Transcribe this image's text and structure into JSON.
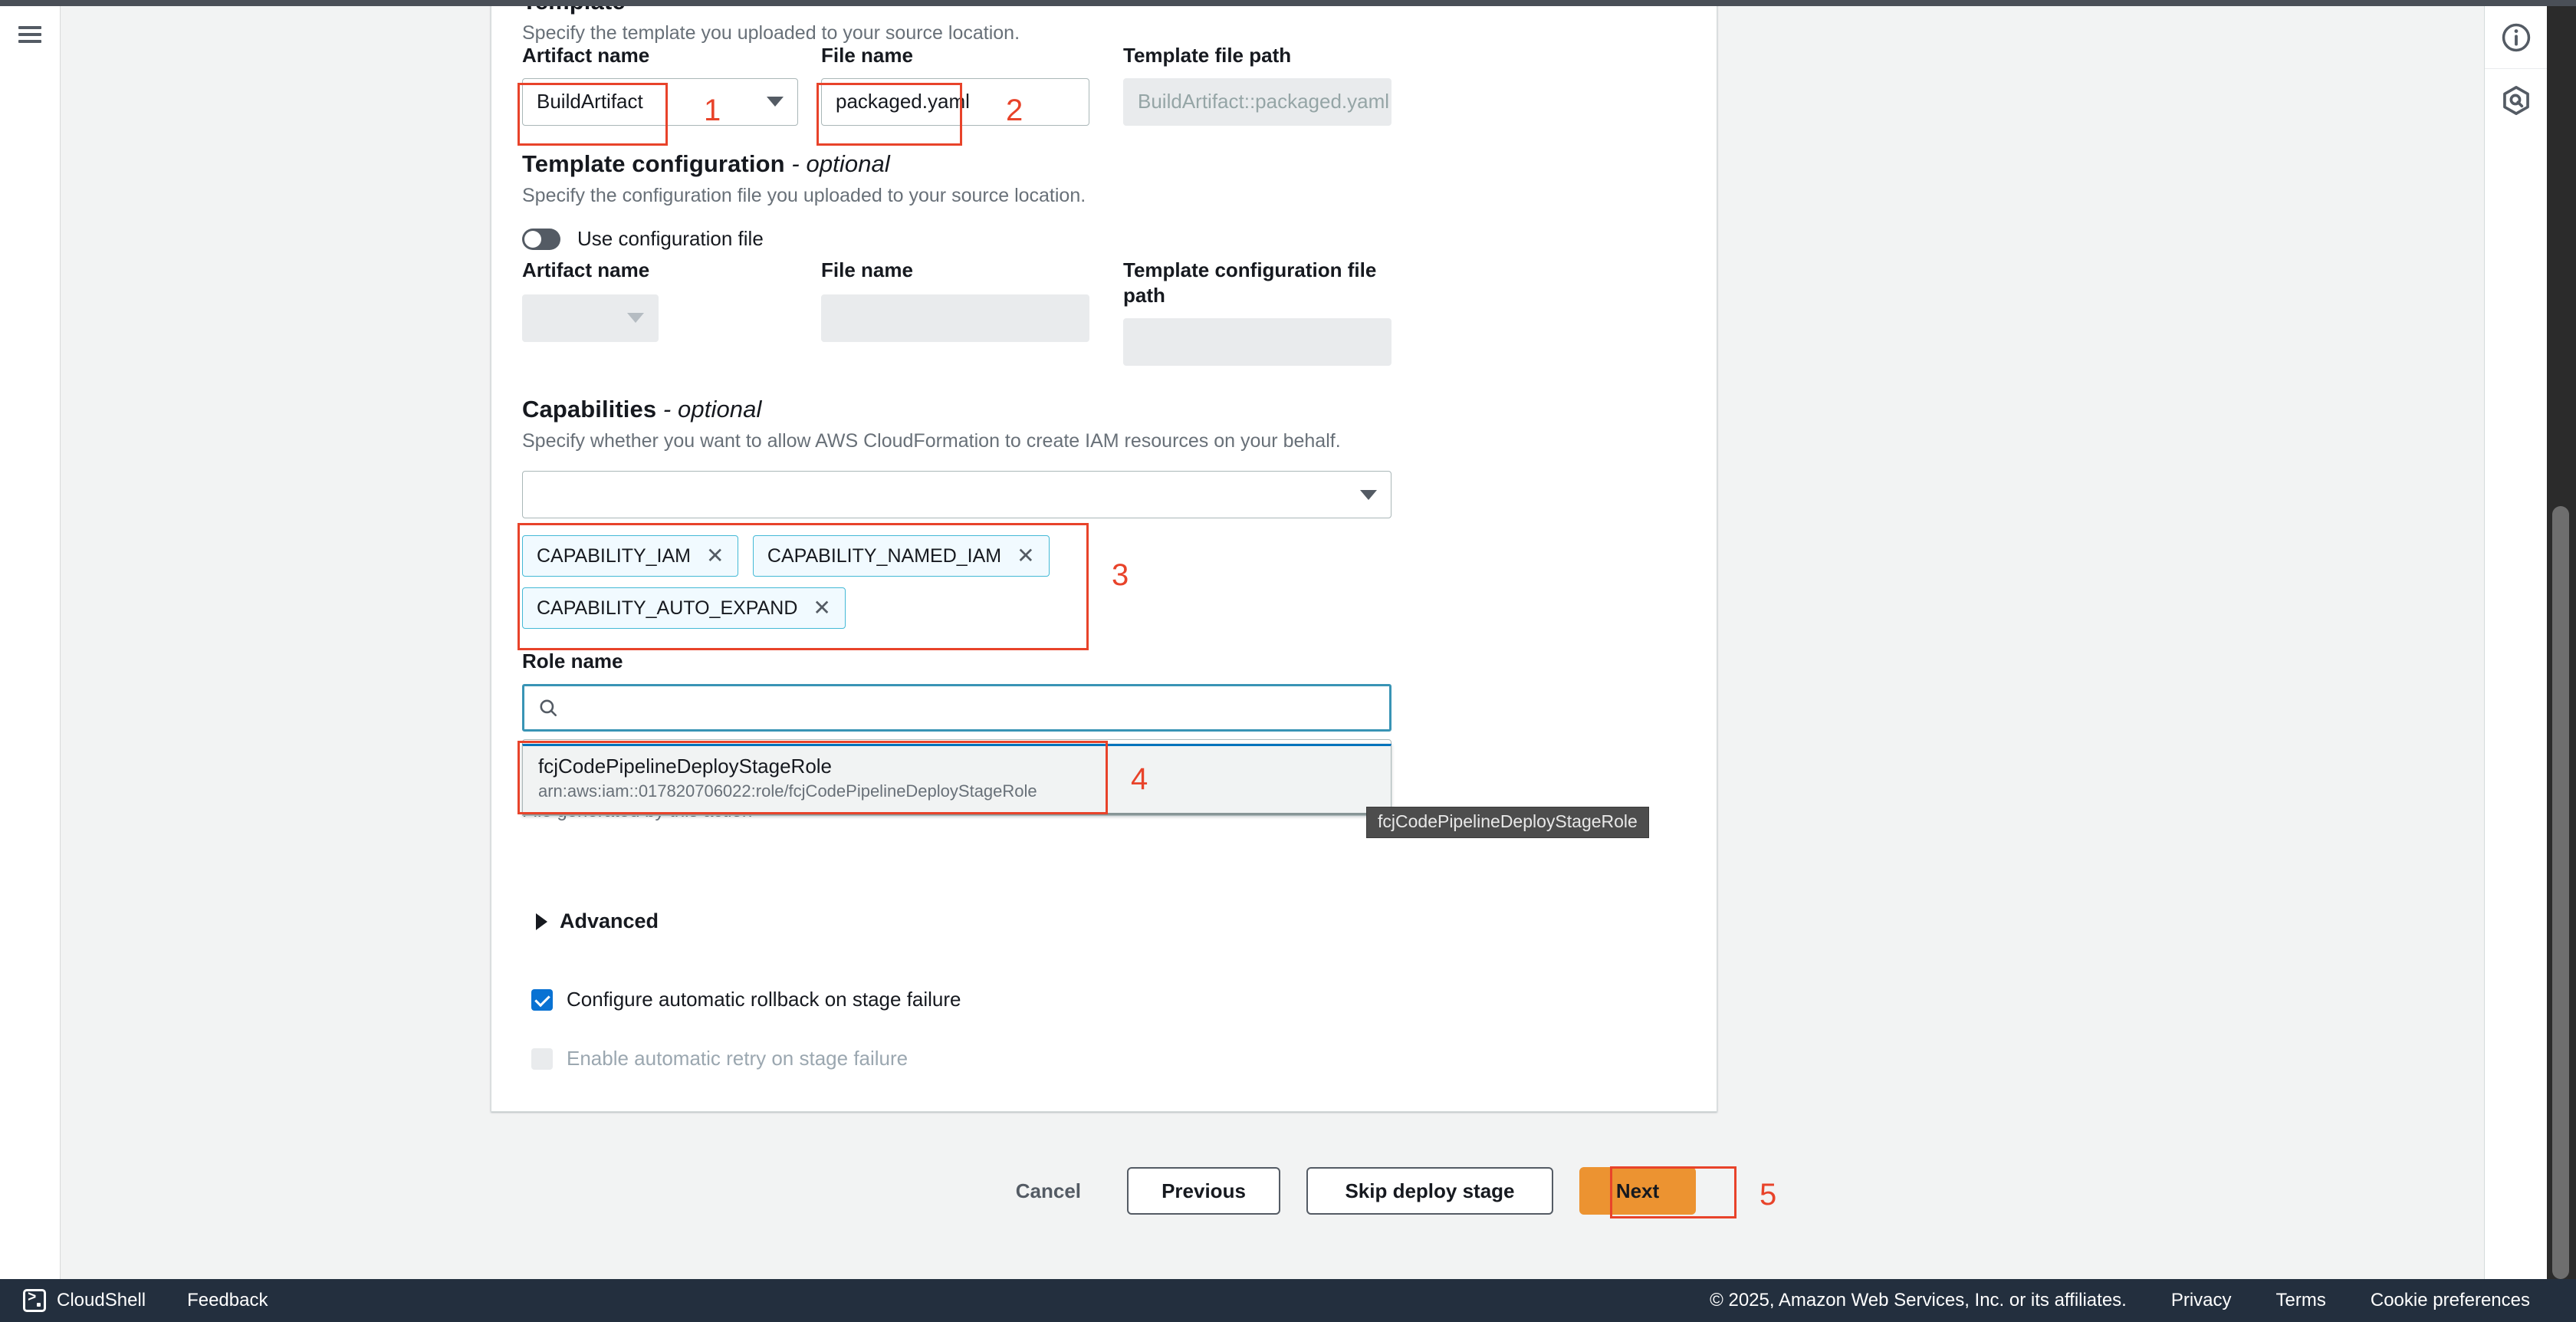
{
  "footer": {
    "cloudshell_label": "CloudShell",
    "feedback_label": "Feedback",
    "copyright": "© 2025, Amazon Web Services, Inc. or its affiliates.",
    "privacy_label": "Privacy",
    "terms_label": "Terms",
    "cookie_label": "Cookie preferences"
  },
  "template_section": {
    "title": "Template",
    "description": "Specify the template you uploaded to your source location.",
    "artifact_name_label": "Artifact name",
    "artifact_name_value": "BuildArtifact",
    "file_name_label": "File name",
    "file_name_value": "packaged.yaml",
    "template_file_path_label": "Template file path",
    "template_file_path_value": "BuildArtifact::packaged.yaml"
  },
  "template_config_section": {
    "title": "Template configuration",
    "optional_suffix": "- optional",
    "description": "Specify the configuration file you uploaded to your source location.",
    "toggle_label": "Use configuration file",
    "toggle_state": "off",
    "artifact_name_label": "Artifact name",
    "artifact_name_value": "",
    "file_name_label": "File name",
    "file_name_value": "",
    "config_file_path_label": "Template configuration file path",
    "config_file_path_value": ""
  },
  "capabilities_section": {
    "title": "Capabilities",
    "optional_suffix": "- optional",
    "description": "Specify whether you want to allow AWS CloudFormation to create IAM resources on your behalf.",
    "select_value": "",
    "tokens": [
      {
        "label": "CAPABILITY_IAM",
        "remove_icon": "close-icon"
      },
      {
        "label": "CAPABILITY_NAMED_IAM",
        "remove_icon": "close-icon"
      },
      {
        "label": "CAPABILITY_AUTO_EXPAND",
        "remove_icon": "close-icon"
      }
    ]
  },
  "role_section": {
    "label": "Role name",
    "search_icon": "search-icon",
    "search_value": "",
    "dropdown_options": [
      {
        "name": "fcjCodePipelineDeployStageRole",
        "arn": "arn:aws:iam::017820706022:role/fcjCodePipelineDeployStageRole"
      }
    ],
    "tooltip_text": "fcjCodePipelineDeployStageRole",
    "hint": "File generated by this action"
  },
  "advanced_section": {
    "label": "Advanced",
    "expanded": false,
    "icon": "chevron-right-icon"
  },
  "options": [
    {
      "label": "Configure automatic rollback on stage failure",
      "checked": true,
      "disabled": false
    },
    {
      "label": "Enable automatic retry on stage failure",
      "checked": false,
      "disabled": true
    }
  ],
  "actions": {
    "cancel_label": "Cancel",
    "previous_label": "Previous",
    "skip_label": "Skip deploy stage",
    "next_label": "Next"
  },
  "annotations": [
    {
      "id": "1",
      "number": "1"
    },
    {
      "id": "2",
      "number": "2"
    },
    {
      "id": "3",
      "number": "3"
    },
    {
      "id": "4",
      "number": "4"
    },
    {
      "id": "5",
      "number": "5"
    }
  ],
  "rails": {
    "menu_icon": "hamburger-menu-icon",
    "info_icon": "info-circle-icon",
    "assistant_icon": "aws-q-hexagon-icon"
  },
  "colors": {
    "annotation_red": "#e8432a",
    "primary_orange": "#ec9331",
    "checkbox_blue": "#0972d3",
    "token_border_blue": "#44b9d6",
    "focus_blue": "#3994b5",
    "footer_navy": "#232f3e"
  }
}
